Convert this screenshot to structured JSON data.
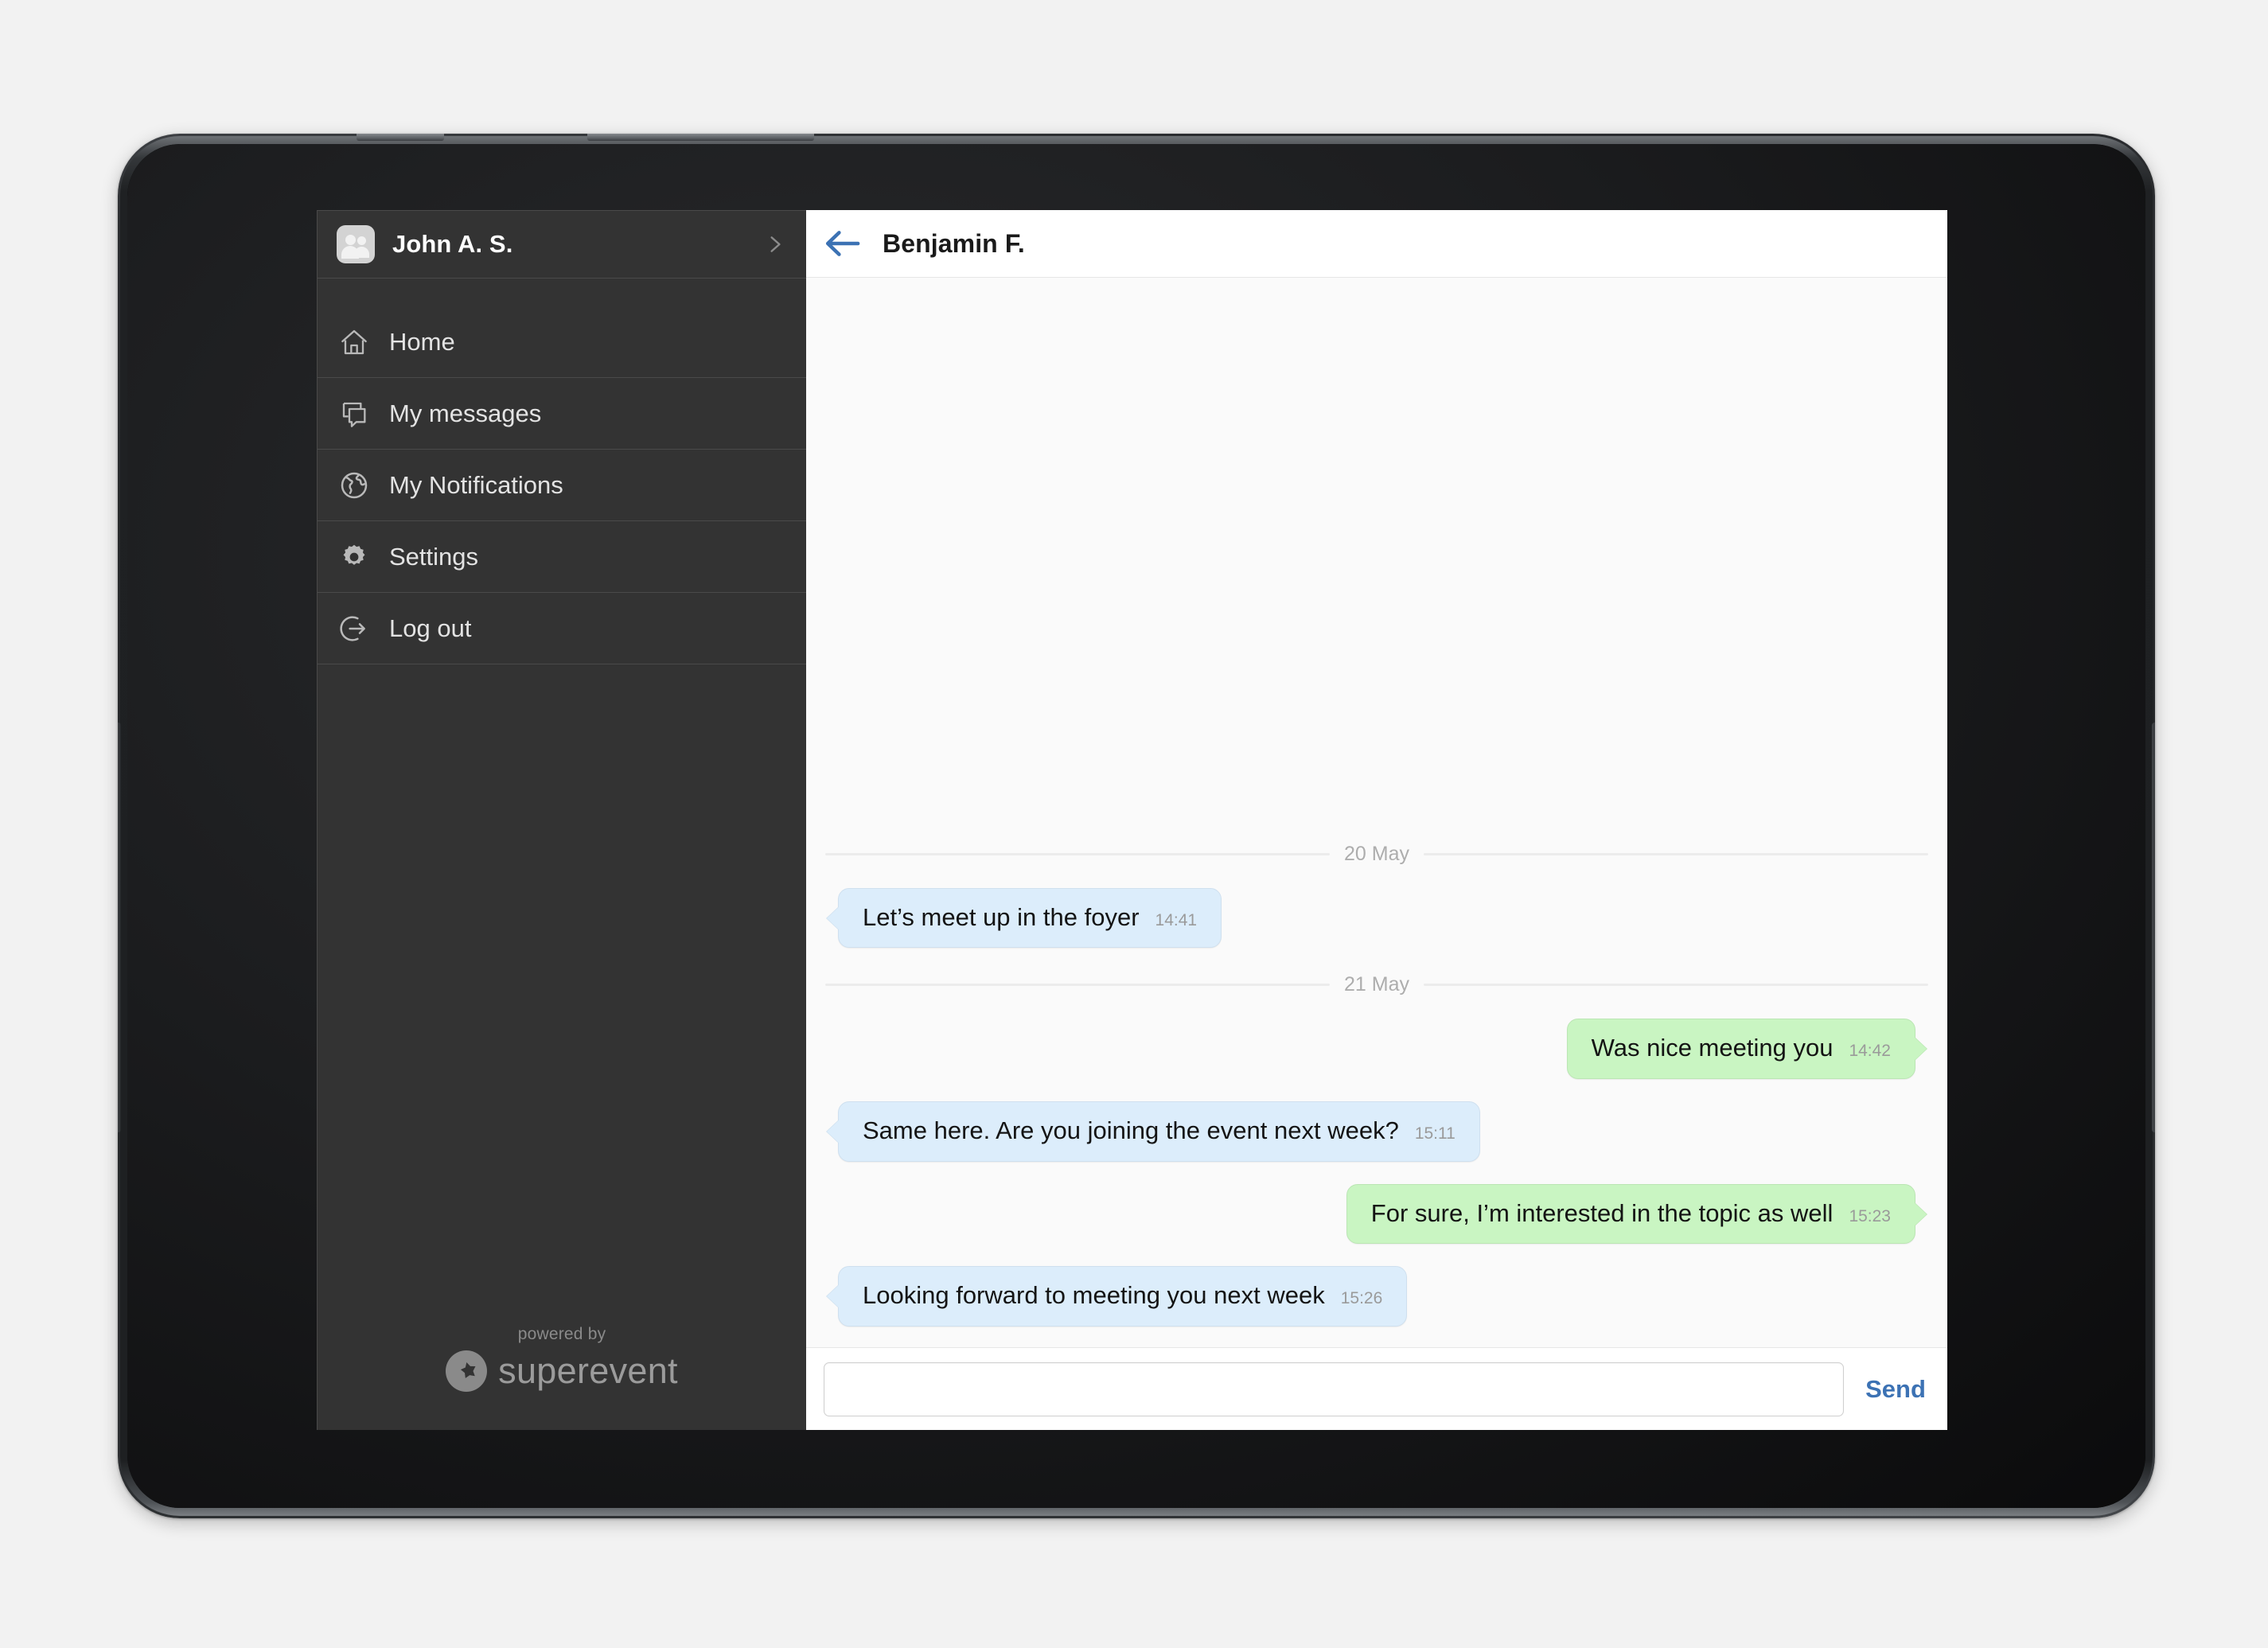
{
  "device": {
    "type": "tablet",
    "frame_color": "#2b2d30",
    "background_color": "#f2f2f2"
  },
  "sidebar": {
    "background_color": "#333333",
    "profile": {
      "name": "John A. S.",
      "avatar_icon": "people-avatar-icon",
      "chevron_icon": "chevron-right-icon"
    },
    "items": [
      {
        "label": "Home",
        "icon": "home-icon"
      },
      {
        "label": "My messages",
        "icon": "chat-bubbles-icon"
      },
      {
        "label": "My Notifications",
        "icon": "globe-icon"
      },
      {
        "label": "Settings",
        "icon": "gear-icon"
      },
      {
        "label": "Log out",
        "icon": "logout-arrow-icon"
      }
    ],
    "footer": {
      "powered_by": "powered by",
      "brand": "superevent",
      "brand_icon": "star-badge-icon"
    }
  },
  "chat": {
    "header": {
      "back_icon": "back-arrow-icon",
      "title": "Benjamin F.",
      "accent_color": "#3c72b4"
    },
    "incoming_bubble_color": "#dcedfb",
    "outgoing_bubble_color": "#c9f5c2",
    "thread": [
      {
        "kind": "date",
        "label": "20 May"
      },
      {
        "kind": "message",
        "direction": "in",
        "text": "Let’s meet up in the foyer",
        "time": "14:41"
      },
      {
        "kind": "date",
        "label": "21 May"
      },
      {
        "kind": "message",
        "direction": "out",
        "text": "Was nice meeting you",
        "time": "14:42"
      },
      {
        "kind": "message",
        "direction": "in",
        "text": "Same here. Are you joining the event next week?",
        "time": "15:11"
      },
      {
        "kind": "message",
        "direction": "out",
        "text": "For sure, I’m interested in the topic as well",
        "time": "15:23"
      },
      {
        "kind": "message",
        "direction": "in",
        "text": "Looking forward to meeting you next week",
        "time": "15:26"
      }
    ],
    "composer": {
      "input_value": "",
      "input_placeholder": "",
      "send_label": "Send"
    }
  }
}
